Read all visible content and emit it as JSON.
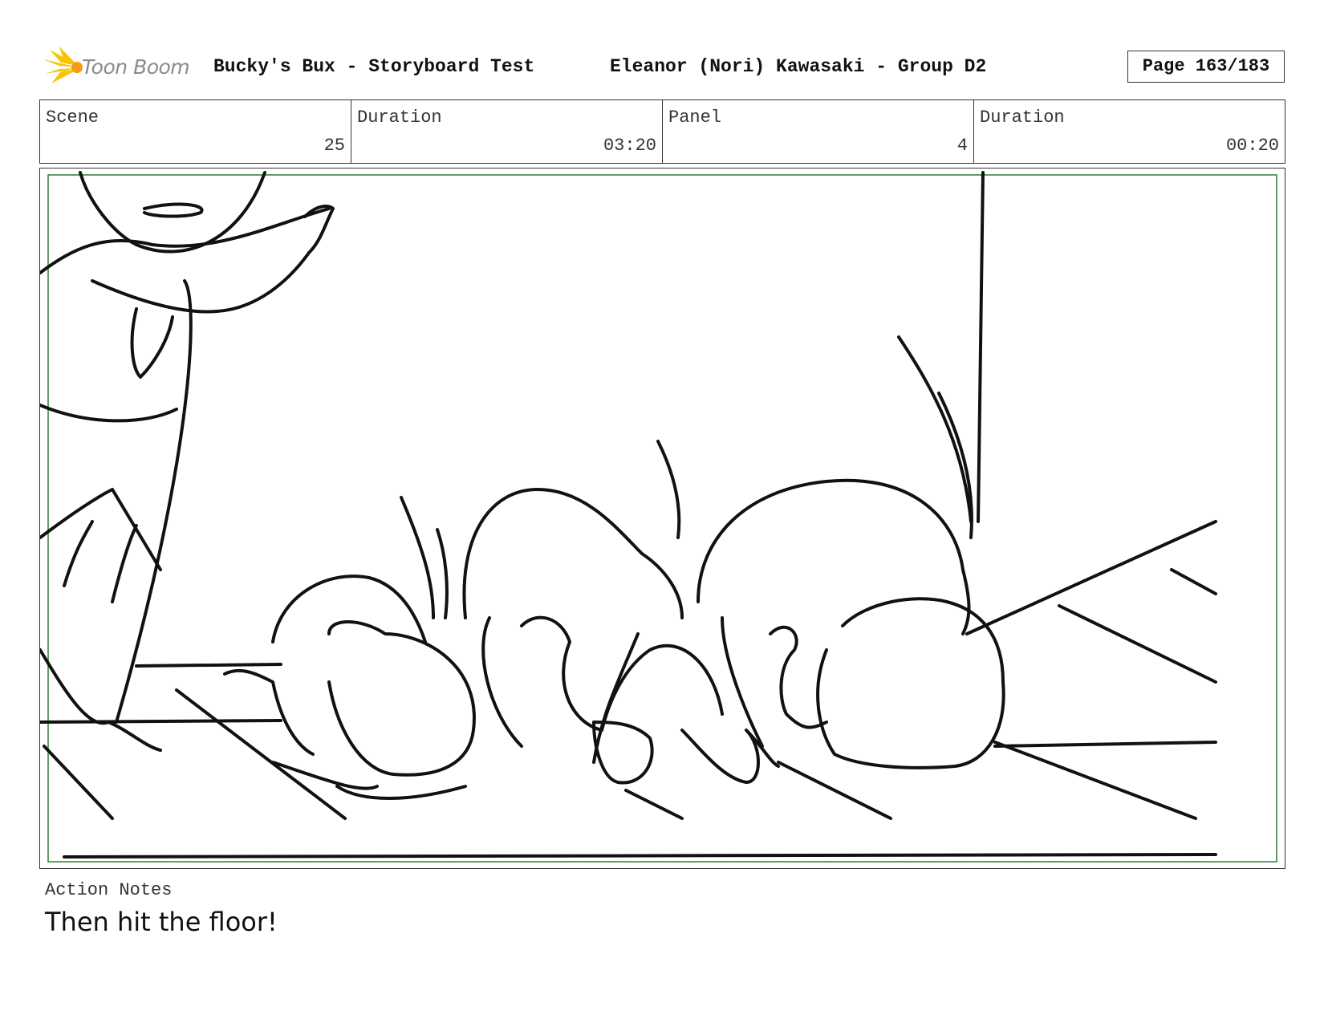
{
  "header": {
    "logo_text": "Toon Boom",
    "project_title": "Bucky's Bux - Storyboard Test",
    "artist_title": "Eleanor (Nori) Kawasaki - Group D2",
    "page_label": "Page 163/183"
  },
  "info": {
    "scene_label": "Scene",
    "scene_value": "25",
    "scene_duration_label": "Duration",
    "scene_duration_value": "03:20",
    "panel_label": "Panel",
    "panel_value": "4",
    "panel_duration_label": "Duration",
    "panel_duration_value": "00:20"
  },
  "notes": {
    "label": "Action Notes",
    "text": "Then hit the floor!"
  },
  "colors": {
    "safe_frame": "#2e7d32",
    "logo_yellow": "#f6c400",
    "logo_orange": "#f39c12"
  }
}
